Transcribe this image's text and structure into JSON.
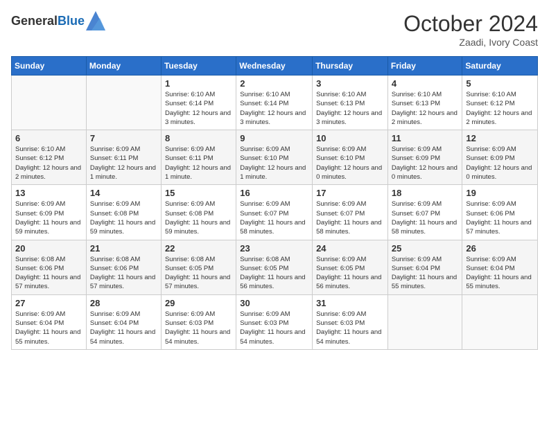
{
  "header": {
    "logo_general": "General",
    "logo_blue": "Blue",
    "month_title": "October 2024",
    "location": "Zaadi, Ivory Coast"
  },
  "weekdays": [
    "Sunday",
    "Monday",
    "Tuesday",
    "Wednesday",
    "Thursday",
    "Friday",
    "Saturday"
  ],
  "weeks": [
    [
      {
        "day": "",
        "info": ""
      },
      {
        "day": "",
        "info": ""
      },
      {
        "day": "1",
        "info": "Sunrise: 6:10 AM\nSunset: 6:14 PM\nDaylight: 12 hours and 3 minutes."
      },
      {
        "day": "2",
        "info": "Sunrise: 6:10 AM\nSunset: 6:14 PM\nDaylight: 12 hours and 3 minutes."
      },
      {
        "day": "3",
        "info": "Sunrise: 6:10 AM\nSunset: 6:13 PM\nDaylight: 12 hours and 3 minutes."
      },
      {
        "day": "4",
        "info": "Sunrise: 6:10 AM\nSunset: 6:13 PM\nDaylight: 12 hours and 2 minutes."
      },
      {
        "day": "5",
        "info": "Sunrise: 6:10 AM\nSunset: 6:12 PM\nDaylight: 12 hours and 2 minutes."
      }
    ],
    [
      {
        "day": "6",
        "info": "Sunrise: 6:10 AM\nSunset: 6:12 PM\nDaylight: 12 hours and 2 minutes."
      },
      {
        "day": "7",
        "info": "Sunrise: 6:09 AM\nSunset: 6:11 PM\nDaylight: 12 hours and 1 minute."
      },
      {
        "day": "8",
        "info": "Sunrise: 6:09 AM\nSunset: 6:11 PM\nDaylight: 12 hours and 1 minute."
      },
      {
        "day": "9",
        "info": "Sunrise: 6:09 AM\nSunset: 6:10 PM\nDaylight: 12 hours and 1 minute."
      },
      {
        "day": "10",
        "info": "Sunrise: 6:09 AM\nSunset: 6:10 PM\nDaylight: 12 hours and 0 minutes."
      },
      {
        "day": "11",
        "info": "Sunrise: 6:09 AM\nSunset: 6:09 PM\nDaylight: 12 hours and 0 minutes."
      },
      {
        "day": "12",
        "info": "Sunrise: 6:09 AM\nSunset: 6:09 PM\nDaylight: 12 hours and 0 minutes."
      }
    ],
    [
      {
        "day": "13",
        "info": "Sunrise: 6:09 AM\nSunset: 6:09 PM\nDaylight: 11 hours and 59 minutes."
      },
      {
        "day": "14",
        "info": "Sunrise: 6:09 AM\nSunset: 6:08 PM\nDaylight: 11 hours and 59 minutes."
      },
      {
        "day": "15",
        "info": "Sunrise: 6:09 AM\nSunset: 6:08 PM\nDaylight: 11 hours and 59 minutes."
      },
      {
        "day": "16",
        "info": "Sunrise: 6:09 AM\nSunset: 6:07 PM\nDaylight: 11 hours and 58 minutes."
      },
      {
        "day": "17",
        "info": "Sunrise: 6:09 AM\nSunset: 6:07 PM\nDaylight: 11 hours and 58 minutes."
      },
      {
        "day": "18",
        "info": "Sunrise: 6:09 AM\nSunset: 6:07 PM\nDaylight: 11 hours and 58 minutes."
      },
      {
        "day": "19",
        "info": "Sunrise: 6:09 AM\nSunset: 6:06 PM\nDaylight: 11 hours and 57 minutes."
      }
    ],
    [
      {
        "day": "20",
        "info": "Sunrise: 6:08 AM\nSunset: 6:06 PM\nDaylight: 11 hours and 57 minutes."
      },
      {
        "day": "21",
        "info": "Sunrise: 6:08 AM\nSunset: 6:06 PM\nDaylight: 11 hours and 57 minutes."
      },
      {
        "day": "22",
        "info": "Sunrise: 6:08 AM\nSunset: 6:05 PM\nDaylight: 11 hours and 57 minutes."
      },
      {
        "day": "23",
        "info": "Sunrise: 6:08 AM\nSunset: 6:05 PM\nDaylight: 11 hours and 56 minutes."
      },
      {
        "day": "24",
        "info": "Sunrise: 6:09 AM\nSunset: 6:05 PM\nDaylight: 11 hours and 56 minutes."
      },
      {
        "day": "25",
        "info": "Sunrise: 6:09 AM\nSunset: 6:04 PM\nDaylight: 11 hours and 55 minutes."
      },
      {
        "day": "26",
        "info": "Sunrise: 6:09 AM\nSunset: 6:04 PM\nDaylight: 11 hours and 55 minutes."
      }
    ],
    [
      {
        "day": "27",
        "info": "Sunrise: 6:09 AM\nSunset: 6:04 PM\nDaylight: 11 hours and 55 minutes."
      },
      {
        "day": "28",
        "info": "Sunrise: 6:09 AM\nSunset: 6:04 PM\nDaylight: 11 hours and 54 minutes."
      },
      {
        "day": "29",
        "info": "Sunrise: 6:09 AM\nSunset: 6:03 PM\nDaylight: 11 hours and 54 minutes."
      },
      {
        "day": "30",
        "info": "Sunrise: 6:09 AM\nSunset: 6:03 PM\nDaylight: 11 hours and 54 minutes."
      },
      {
        "day": "31",
        "info": "Sunrise: 6:09 AM\nSunset: 6:03 PM\nDaylight: 11 hours and 54 minutes."
      },
      {
        "day": "",
        "info": ""
      },
      {
        "day": "",
        "info": ""
      }
    ]
  ]
}
